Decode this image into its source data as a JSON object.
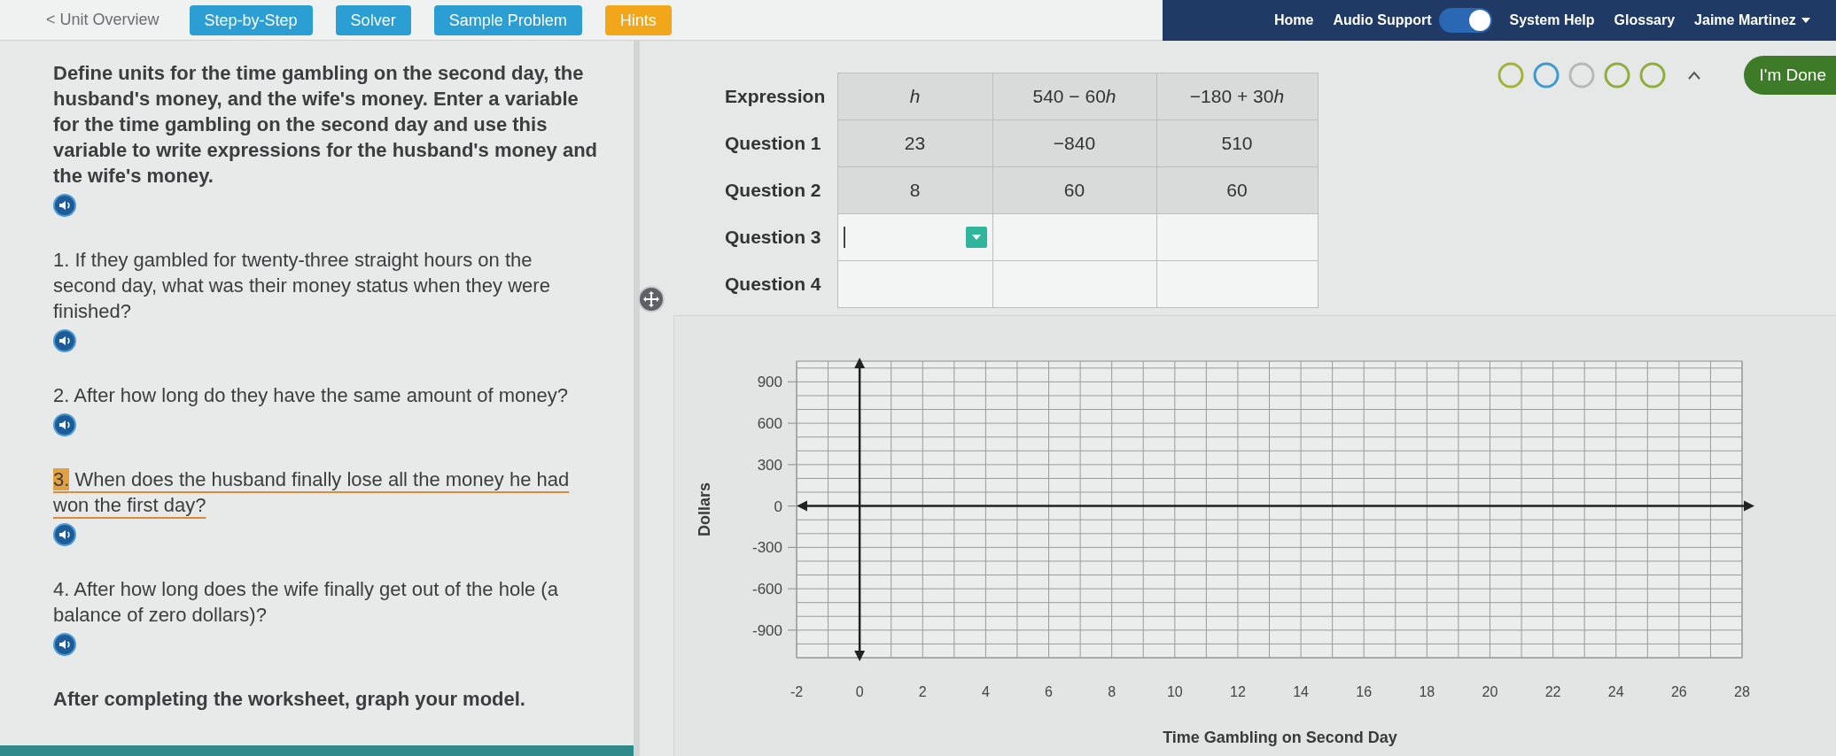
{
  "header": {
    "back_link": "< Unit Overview",
    "buttons": [
      {
        "label": "Step-by-Step",
        "color": "#2b9fd4"
      },
      {
        "label": "Solver",
        "color": "#2b9fd4"
      },
      {
        "label": "Sample Problem",
        "color": "#2b9fd4"
      },
      {
        "label": "Hints",
        "color": "#f2a71b"
      }
    ],
    "nav_items": [
      {
        "kind": "link",
        "label": "Home"
      },
      {
        "kind": "toggle",
        "label": "Audio Support",
        "on": true
      },
      {
        "kind": "link",
        "label": "System Help"
      },
      {
        "kind": "link",
        "label": "Glossary"
      },
      {
        "kind": "menu",
        "label": "Jaime Martinez"
      }
    ]
  },
  "progress": [
    {
      "color": "#a3b23a"
    },
    {
      "color": "#3d9ad0"
    },
    {
      "color": "#b5b9b7"
    },
    {
      "color": "#8fae3c"
    },
    {
      "color": "#8fae3c"
    }
  ],
  "done_button": "I'm Done",
  "worksheet": {
    "intro": "Define units for the time gambling on the second day, the husband's money, and the wife's money. Enter a variable for the time gambling on the second day and use this variable to write expressions for the husband's money and the wife's money.",
    "questions": [
      {
        "number": "1.",
        "text": "If they gambled for twenty-three straight hours on the second day, what was their money status when they were finished?",
        "highlighted": false
      },
      {
        "number": "2.",
        "text": "After how long do they have the same amount of money?",
        "highlighted": false
      },
      {
        "number": "3.",
        "text": "When does the husband finally lose all the money he had won the first day?",
        "highlighted": true
      },
      {
        "number": "4.",
        "text": "After how long does the wife finally get out of the hole (a balance of zero dollars)?",
        "highlighted": false
      }
    ],
    "closing": "After completing the worksheet, graph your model."
  },
  "table": {
    "header_label": "Expression",
    "columns": [
      {
        "kind": "variable",
        "label": "h"
      },
      {
        "kind": "expression",
        "label": "540 − 60",
        "variable": "h"
      },
      {
        "kind": "expression",
        "label": "−180 + 30",
        "variable": "h"
      }
    ],
    "rows": [
      {
        "label": "Question 1",
        "answered": true,
        "editing": false,
        "cells": [
          "23",
          "−840",
          "510"
        ]
      },
      {
        "label": "Question 2",
        "answered": true,
        "editing": false,
        "cells": [
          "8",
          "60",
          "60"
        ]
      },
      {
        "label": "Question 3",
        "answered": false,
        "editing": true
      },
      {
        "label": "Question 4",
        "answered": false,
        "editing": false
      }
    ]
  },
  "graph": {
    "chart_data": {
      "type": "line",
      "xlabel": "Time Gambling on Second Day",
      "ylabel": "Dollars",
      "xlim": [
        -2,
        28
      ],
      "ylim": [
        -1100,
        1050
      ],
      "xticks": [
        -2,
        0,
        2,
        4,
        6,
        8,
        10,
        12,
        14,
        16,
        18,
        20,
        22,
        24,
        26,
        28
      ],
      "yticks": [
        -900,
        -600,
        -300,
        0,
        300,
        600,
        900
      ],
      "grid": true
    }
  }
}
